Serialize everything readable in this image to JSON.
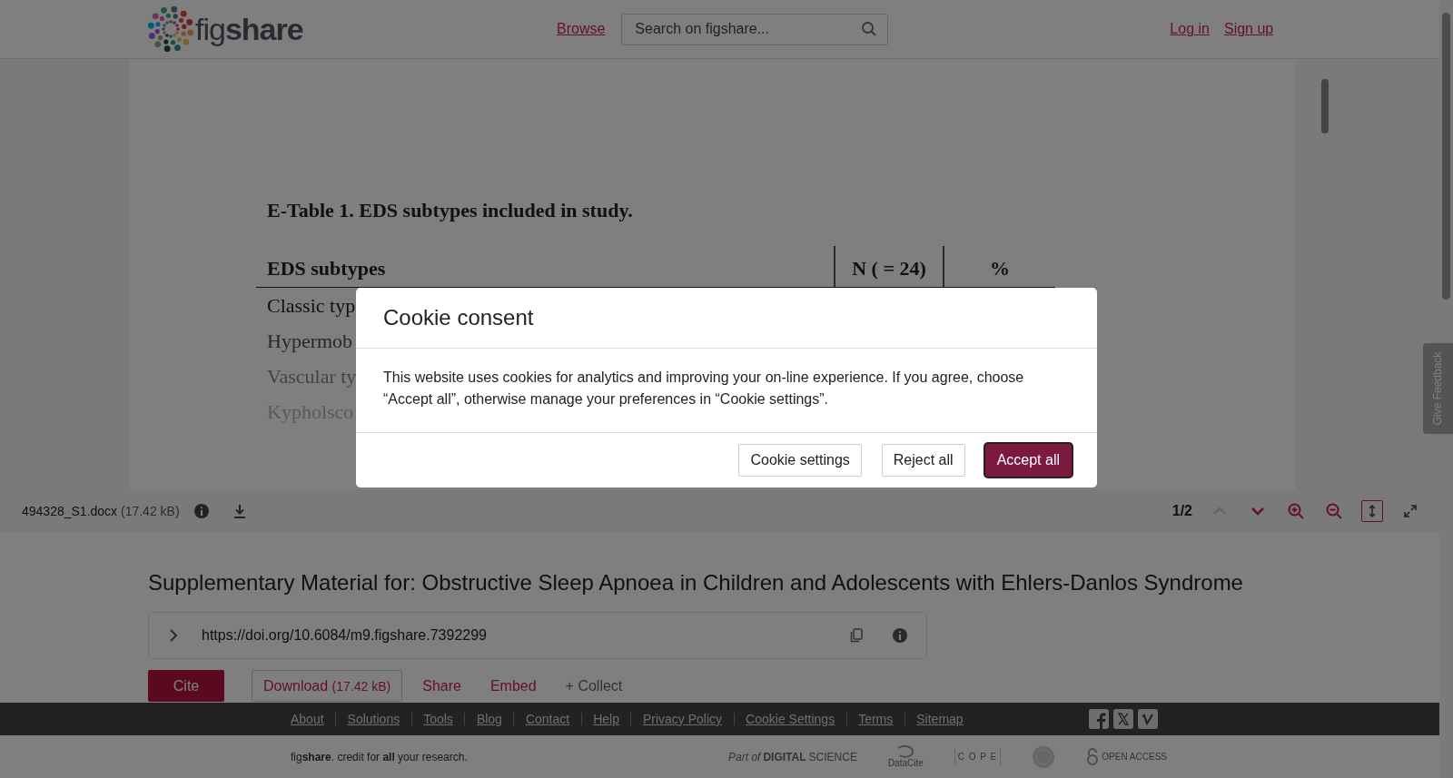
{
  "header": {
    "logo": "fig**share**",
    "nav_link": "Browse",
    "search": {
      "placeholder": "Search on figshare..."
    },
    "auth_links": [
      "Log in",
      "Sign up"
    ]
  },
  "document": {
    "title": "E-Table 1. EDS subtypes included in study.",
    "columns": [
      "EDS subtypes",
      "N ( = 24)",
      "%"
    ],
    "rows": [
      "Classic typ",
      "Hypermob",
      "Vascular ty",
      "Kypholsco"
    ]
  },
  "viewer_toolbar": {
    "file_name": "494328_S1.docx",
    "file_size": "(17.42 kB)",
    "page": "1/2",
    "page_nav": [
      {
        "kind": "prev",
        "disabled": true
      },
      {
        "kind": "next",
        "disabled": false
      }
    ],
    "view_tools": [
      {
        "kind": "zoom_in",
        "selected": false
      },
      {
        "kind": "zoom_out",
        "selected": false
      },
      {
        "kind": "fit_height",
        "selected": true
      },
      {
        "kind": "fullscreen",
        "selected": false
      }
    ]
  },
  "feedback_tab": "Give Feedback",
  "item": {
    "title": "Supplementary Material for: Obstructive Sleep Apnoea in Children and Adolescents with Ehlers-Danlos Syndrome",
    "doi": "https://doi.org/10.6084/m9.figshare.7392299",
    "actions": {
      "cite": "Cite",
      "download": "Download",
      "download_size": "(17.42 kB)",
      "share": "Share",
      "embed": "Embed",
      "collect": "+ Collect"
    }
  },
  "footer": {
    "links": [
      "About",
      "Solutions",
      "Tools",
      "Blog",
      "Contact",
      "Help",
      "Privacy Policy",
      "Cookie Settings",
      "Terms",
      "Sitemap"
    ],
    "social": [
      {
        "kind": "facebook"
      },
      {
        "kind": "x"
      },
      {
        "kind": "vimeo"
      }
    ],
    "tagline": "fig**share**. credit for **all** your research.",
    "partners": [
      {
        "kind": "digital_science",
        "text": "*Part of* **DIGITAL**SCIENCE"
      },
      {
        "kind": "datacite",
        "text": "DataCite"
      },
      {
        "kind": "cope",
        "text": "C O P E"
      },
      {
        "kind": "seal"
      },
      {
        "kind": "open_access",
        "text": "OPEN ACCESS"
      }
    ]
  },
  "cookie_modal": {
    "title": "Cookie consent",
    "body": "This website uses cookies for analytics and improving your on-line experience. If you agree, choose “Accept all”, otherwise manage your preferences in “Cookie settings”.",
    "buttons": [
      {
        "label": "Cookie settings",
        "kind": "secondary"
      },
      {
        "label": "Reject all",
        "kind": "secondary"
      },
      {
        "label": "Accept all",
        "kind": "primary"
      }
    ]
  }
}
